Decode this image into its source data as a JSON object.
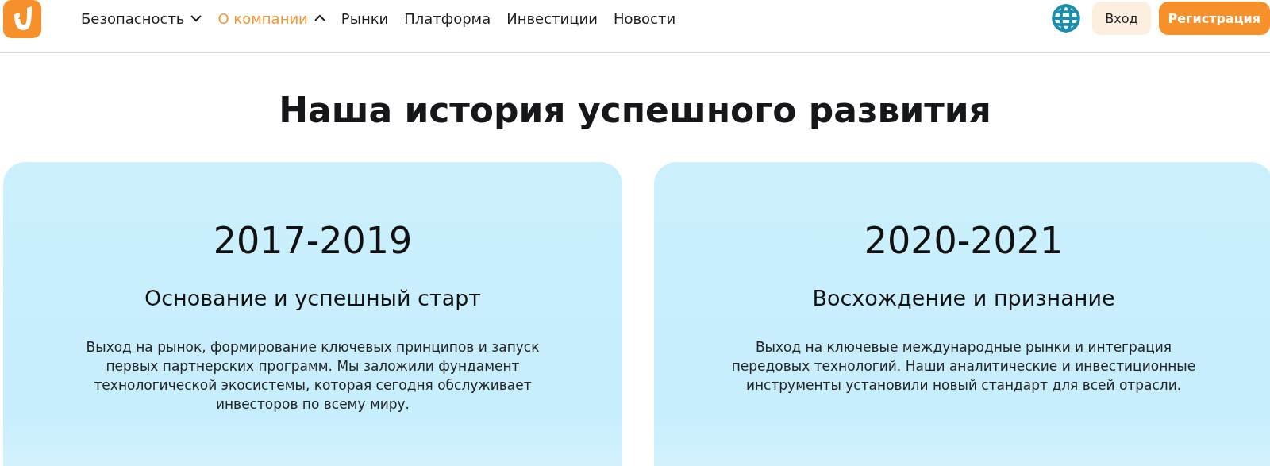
{
  "nav": {
    "items": [
      {
        "label": "Безопасность",
        "kind": "dropdown",
        "expanded": false,
        "selected": false
      },
      {
        "label": "О компании",
        "kind": "dropdown",
        "expanded": true,
        "selected": true
      },
      {
        "label": "Рынки",
        "kind": "link",
        "selected": false
      },
      {
        "label": "Платформа",
        "kind": "link",
        "selected": false
      },
      {
        "label": "Инвестиции",
        "kind": "link",
        "selected": false
      },
      {
        "label": "Новости",
        "kind": "link",
        "selected": false
      }
    ],
    "login": "Вход",
    "register": "Регистрация"
  },
  "heading": "Наша история успешного развития",
  "cards": [
    {
      "years": "2017-2019",
      "title": "Основание и успешный старт",
      "text": "Выход на рынок, формирование ключевых принципов и запуск первых партнерских программ. Мы заложили фундамент технологической экосистемы, которая сегодня обслуживает инвесторов по всему миру."
    },
    {
      "years": "2020-2021",
      "title": "Восхождение и признание",
      "text": "Выход на ключевые международные рынки и интеграция передовых технологий. Наши аналитические и инвестиционные инструменты установили новый стандарт для всей отрасли."
    }
  ]
}
